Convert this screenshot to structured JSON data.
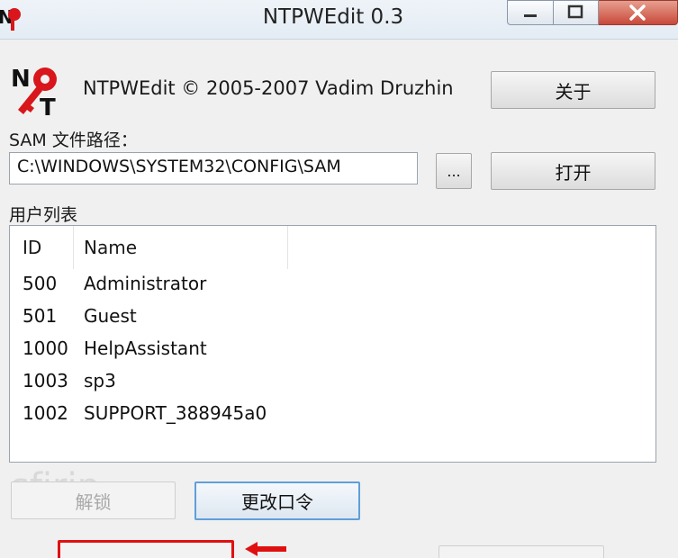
{
  "window": {
    "title": "NTPWEdit 0.3",
    "controls": [
      "minimize",
      "maximize",
      "close"
    ]
  },
  "header": {
    "copyright": "NTPWEdit © 2005-2007 Vadim Druzhin",
    "about_label": "关于",
    "logo_icon": "ntpwedit-key-logo-icon"
  },
  "sam": {
    "label": "SAM 文件路径：",
    "path_value": "C:\\WINDOWS\\SYSTEM32\\CONFIG\\SAM",
    "browse_label": "...",
    "open_label": "打开"
  },
  "users": {
    "label": "用户列表",
    "columns": [
      "ID",
      "Name"
    ],
    "rows": [
      {
        "id": "500",
        "name": "Administrator"
      },
      {
        "id": "501",
        "name": "Guest"
      },
      {
        "id": "1000",
        "name": "HelpAssistant"
      },
      {
        "id": "1003",
        "name": "sp3"
      },
      {
        "id": "1002",
        "name": "SUPPORT_388945a0"
      }
    ]
  },
  "actions": {
    "unlock_label": "解锁",
    "change_password_label": "更改口令"
  },
  "watermark": "sfjrjp",
  "colors": {
    "highlight_box": "#e01010",
    "focus_border": "#5f9fd9",
    "close_button": "#c8493a"
  }
}
